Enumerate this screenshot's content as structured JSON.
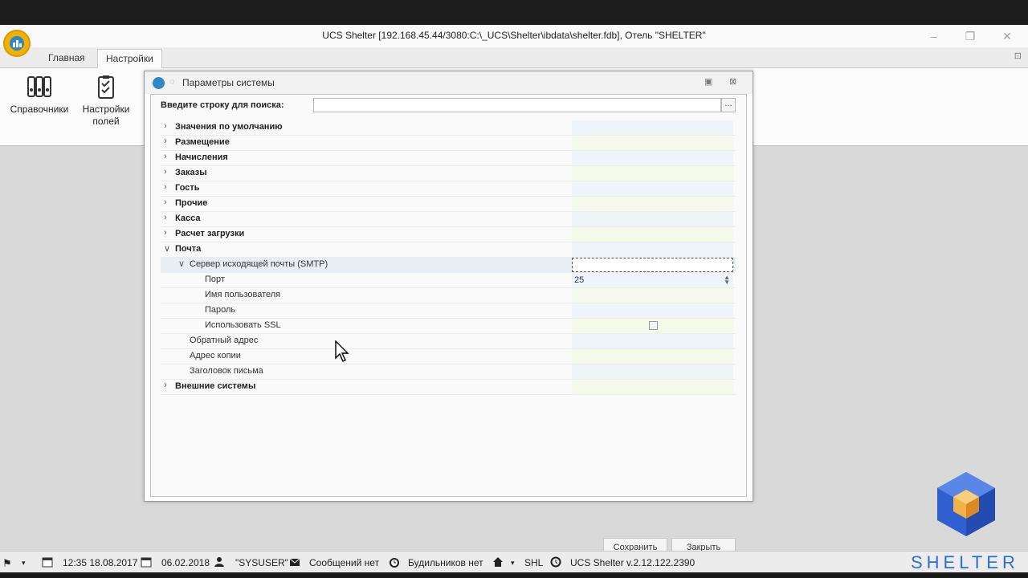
{
  "window": {
    "title": "UCS Shelter [192.168.45.44/3080:C:\\_UCS\\Shelter\\ibdata\\shelter.fdb], Отель \"SHELTER\""
  },
  "ribbon": {
    "tabs": [
      {
        "label": "Главная",
        "active": false
      },
      {
        "label": "Настройки",
        "active": true
      }
    ],
    "buttons": [
      {
        "label": "Справочники",
        "icon": "binders-icon"
      },
      {
        "label": "Настройки полей",
        "icon": "clipboard-check-icon"
      }
    ]
  },
  "dialog": {
    "title": "Параметры системы",
    "search": {
      "label": "Введите строку для поиска:",
      "value": "",
      "placeholder": "",
      "more_label": "..."
    },
    "rows": [
      {
        "name": "Значения по умолчанию",
        "level": 0,
        "expand": "collapsed",
        "bold": true,
        "value": ""
      },
      {
        "name": "Размещение",
        "level": 0,
        "expand": "collapsed",
        "bold": true,
        "value": ""
      },
      {
        "name": "Начисления",
        "level": 0,
        "expand": "collapsed",
        "bold": true,
        "value": ""
      },
      {
        "name": "Заказы",
        "level": 0,
        "expand": "collapsed",
        "bold": true,
        "value": ""
      },
      {
        "name": "Гость",
        "level": 0,
        "expand": "collapsed",
        "bold": true,
        "value": ""
      },
      {
        "name": "Прочие",
        "level": 0,
        "expand": "collapsed",
        "bold": true,
        "value": ""
      },
      {
        "name": "Касса",
        "level": 0,
        "expand": "collapsed",
        "bold": true,
        "value": ""
      },
      {
        "name": "Расчет загрузки",
        "level": 0,
        "expand": "collapsed",
        "bold": true,
        "value": ""
      },
      {
        "name": "Почта",
        "level": 0,
        "expand": "expanded",
        "bold": true,
        "value": ""
      },
      {
        "name": "Сервер исходящей почты (SMTP)",
        "level": 1,
        "expand": "expanded",
        "bold": false,
        "value": "",
        "selected": true
      },
      {
        "name": "Порт",
        "level": 2,
        "expand": "none",
        "bold": false,
        "value": "25",
        "editor": "spin"
      },
      {
        "name": "Имя пользователя",
        "level": 2,
        "expand": "none",
        "bold": false,
        "value": ""
      },
      {
        "name": "Пароль",
        "level": 2,
        "expand": "none",
        "bold": false,
        "value": ""
      },
      {
        "name": "Использовать SSL",
        "level": 2,
        "expand": "none",
        "bold": false,
        "value": "",
        "editor": "checkbox",
        "checked": false
      },
      {
        "name": "Обратный адрес",
        "level": 1,
        "expand": "none",
        "bold": false,
        "value": ""
      },
      {
        "name": "Адрес копии",
        "level": 1,
        "expand": "none",
        "bold": false,
        "value": ""
      },
      {
        "name": "Заголовок письма",
        "level": 1,
        "expand": "none",
        "bold": false,
        "value": ""
      },
      {
        "name": "Внешние системы",
        "level": 0,
        "expand": "collapsed",
        "bold": true,
        "value": ""
      }
    ],
    "save_label": "Сохранить",
    "close_label": "Закрыть"
  },
  "statusbar": {
    "session_datetime": "12:35 18.08.2017",
    "work_date": "06.02.2018",
    "user": "\"SYSUSER\"",
    "messages": "Сообщений нет",
    "alarms": "Будильников нет",
    "hotel_code": "SHL",
    "version": "UCS Shelter v.2.12.122.2390"
  },
  "brand": {
    "text": "SHELTER"
  },
  "colors": {
    "brand_blue": "#2a6fd6",
    "logo_yellow": "#f2b000",
    "value_odd": "#eef4fa",
    "value_even": "#f5f9ea"
  }
}
